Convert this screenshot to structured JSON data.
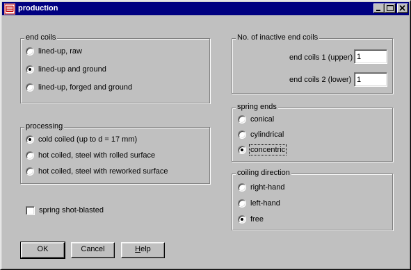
{
  "window": {
    "title": "production"
  },
  "end_coils": {
    "title": "end coils",
    "options": [
      {
        "label": "lined-up, raw",
        "checked": false
      },
      {
        "label": "lined-up and ground",
        "checked": true
      },
      {
        "label": "lined-up, forged and ground",
        "checked": false
      }
    ]
  },
  "processing": {
    "title": "processing",
    "options": [
      {
        "label": "cold coiled (up to d = 17 mm)",
        "checked": true
      },
      {
        "label": "hot coiled, steel with rolled surface",
        "checked": false
      },
      {
        "label": "hot coiled, steel with reworked surface",
        "checked": false
      }
    ]
  },
  "shot_blasted": {
    "label": "spring shot-blasted",
    "checked": false
  },
  "inactive_end_coils": {
    "title": "No. of inactive end coils",
    "upper_label": "end coils 1 (upper)",
    "upper_value": "1",
    "lower_label": "end coils 2 (lower)",
    "lower_value": "1"
  },
  "spring_ends": {
    "title": "spring ends",
    "options": [
      {
        "label": "conical",
        "checked": false
      },
      {
        "label": "cylindrical",
        "checked": false
      },
      {
        "label": "concentric",
        "checked": true
      }
    ]
  },
  "coiling_direction": {
    "title": "coiling direction",
    "options": [
      {
        "label": "right-hand",
        "checked": false
      },
      {
        "label": "left-hand",
        "checked": false
      },
      {
        "label": "free",
        "checked": true
      }
    ]
  },
  "buttons": {
    "ok": "OK",
    "cancel": "Cancel",
    "help": "Help"
  }
}
